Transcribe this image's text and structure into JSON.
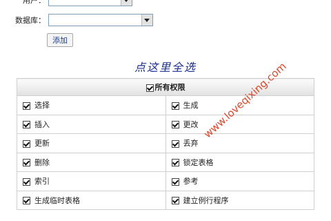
{
  "form": {
    "user_label": "用户：",
    "db_label": "数据库：",
    "add_button": "添加"
  },
  "select_all_link": "点这里全选",
  "permissions": {
    "header": "所有权限",
    "rows": [
      [
        "选择",
        "生成"
      ],
      [
        "插入",
        "更改"
      ],
      [
        "更新",
        "丢弃"
      ],
      [
        "删除",
        "锁定表格"
      ],
      [
        "索引",
        "参考"
      ],
      [
        "生成临时表格",
        "建立例行程序"
      ]
    ]
  },
  "watermark": "www.loveqixing.com",
  "colors": {
    "link": "#1b2d8f",
    "watermark": "#e0462a"
  }
}
